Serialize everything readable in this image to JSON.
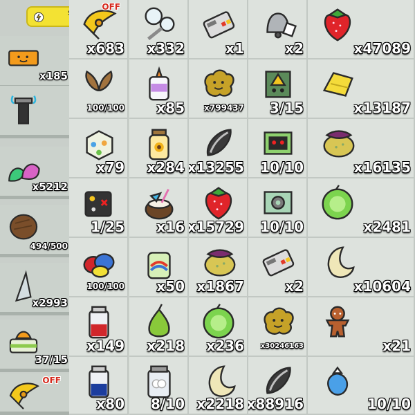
{
  "colors": {
    "cell_bg": "#dde2dd",
    "grid_line": "#c2c8c3",
    "sidebar_bg": "#c9cfca",
    "pill_yellow": "#f3e233",
    "off_red": "#d62a1d"
  },
  "sidebar": {
    "top_pill": {
      "icon": "lightning-coin-icon",
      "text": "S"
    },
    "items": [
      {
        "icon": "ticket-icon",
        "count": "x185"
      },
      {
        "icon": "sprinkler-icon",
        "count": ""
      },
      {
        "icon": "gumdrops-icon",
        "count": "x5212"
      },
      {
        "icon": "coconut-icon",
        "count": "494/500"
      },
      {
        "icon": "stinger-icon",
        "count": "x2993"
      },
      {
        "icon": "pineapple-patch-planter-icon",
        "count": "37/15"
      },
      {
        "icon": "glider-icon",
        "count": "",
        "badge": "OFF"
      }
    ]
  },
  "grid": {
    "rows": [
      [
        {
          "icon": "glider-icon",
          "count": "x683",
          "badge": "OFF"
        },
        {
          "icon": "bubble-wand-icon",
          "count": "x332"
        },
        {
          "icon": "remote-control-icon",
          "count": "x1"
        },
        {
          "icon": "bell-icon",
          "count": "x2"
        },
        {
          "icon": "strawberry-icon",
          "count": "x47089"
        }
      ],
      [
        {
          "icon": "wings-icon",
          "count": "100/100"
        },
        {
          "icon": "glue-bottle-icon",
          "count": "x85"
        },
        {
          "icon": "cheese-cloud-icon",
          "count": "x799437"
        },
        {
          "icon": "warning-box-icon",
          "count": "3/15"
        },
        {
          "icon": "pineapple-icon",
          "count": "x13187"
        }
      ],
      [
        {
          "icon": "present-box-icon",
          "count": "x79"
        },
        {
          "icon": "sunflower-jar-icon",
          "count": "x284"
        },
        {
          "icon": "sunflower-seed-icon",
          "count": "x13255"
        },
        {
          "icon": "robot-card-icon",
          "count": "10/10"
        },
        {
          "icon": "moon-melon-icon",
          "count": "x16135"
        }
      ],
      [
        {
          "icon": "dice-icon",
          "count": "1/25"
        },
        {
          "icon": "coconut-drink-icon",
          "count": "x16"
        },
        {
          "icon": "strawberry-icon",
          "count": "x15729"
        },
        {
          "icon": "gear-card-icon",
          "count": "10/10"
        },
        {
          "icon": "melon-icon",
          "count": "x2481"
        }
      ],
      [
        {
          "icon": "berries-icon",
          "count": "100/100"
        },
        {
          "icon": "juice-jar-icon",
          "count": "x50"
        },
        {
          "icon": "moon-melon-icon",
          "count": "x1867"
        },
        {
          "icon": "remote-control-icon",
          "count": "x2"
        },
        {
          "icon": "moon-icon",
          "count": "x10604"
        }
      ],
      [
        {
          "icon": "red-jar-icon",
          "count": "x149"
        },
        {
          "icon": "pear-icon",
          "count": "x218"
        },
        {
          "icon": "melon-icon",
          "count": "x236"
        },
        {
          "icon": "cheese-cloud-icon",
          "count": "x30246163"
        },
        {
          "icon": "gingerbread-icon",
          "count": "x21"
        }
      ],
      [
        {
          "icon": "blue-jar-icon",
          "count": "x80"
        },
        {
          "icon": "cloud-jar-icon",
          "count": "8/10"
        },
        {
          "icon": "moon-icon",
          "count": "x2218"
        },
        {
          "icon": "sunflower-seed-icon",
          "count": "x88916"
        },
        {
          "icon": "magic-bean-icon",
          "count": "10/10"
        }
      ]
    ]
  }
}
